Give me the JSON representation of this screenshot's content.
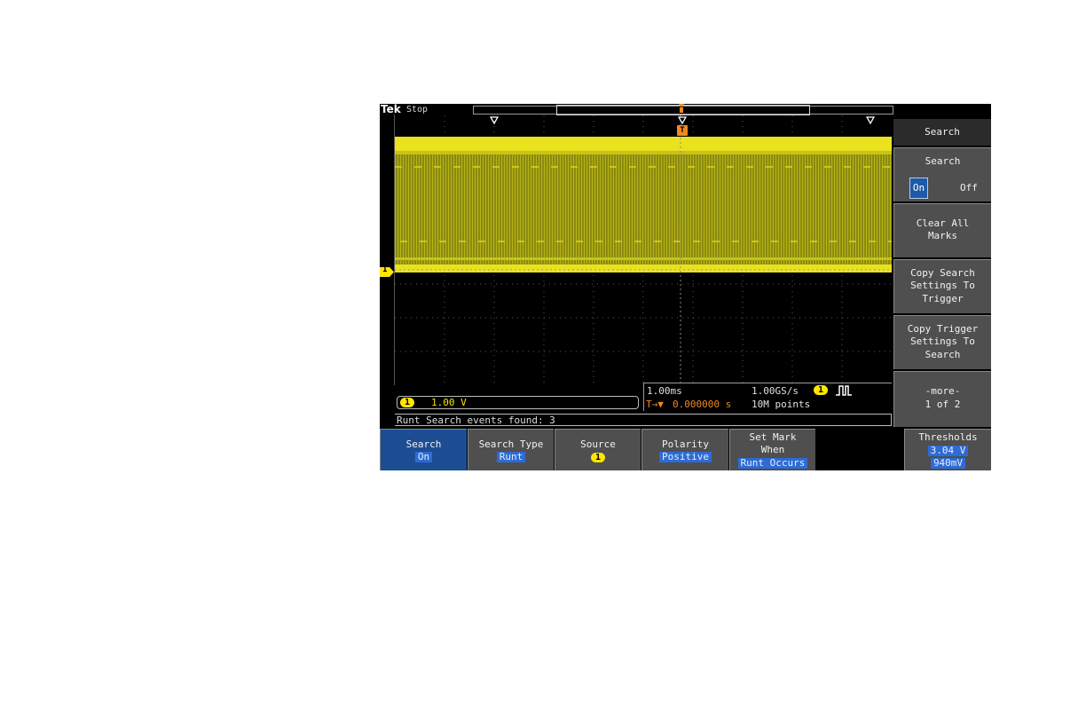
{
  "brand": "Tek",
  "run_state": "Stop",
  "channel1": {
    "badge": "1",
    "scale": "1.00 V"
  },
  "trigger_badge": "T",
  "timebase": {
    "horizontal_scale": "1.00ms",
    "sample_rate": "1.00GS/s",
    "trigger_position_symbol": "T→▼",
    "delay": "0.000000 s",
    "record_length": "10M points",
    "trigger_source_badge": "1"
  },
  "status_message": "Runt Search events found: 3",
  "side_menu": {
    "title": "Search",
    "search_toggle": {
      "label": "Search",
      "on": "On",
      "off": "Off"
    },
    "clear_all_marks": [
      "Clear All",
      "Marks"
    ],
    "copy_search_to_trigger": [
      "Copy Search",
      "Settings To",
      "Trigger"
    ],
    "copy_trigger_to_search": [
      "Copy Trigger",
      "Settings To",
      "Search"
    ],
    "more": [
      "-more-",
      "1 of 2"
    ]
  },
  "bottom_menu": {
    "search": {
      "label": "Search",
      "value": "On"
    },
    "search_type": {
      "label": "Search Type",
      "value": "Runt"
    },
    "source": {
      "label": "Source",
      "value": "1"
    },
    "polarity": {
      "label": "Polarity",
      "value": "Positive"
    },
    "set_mark_when": {
      "label_line1": "Set Mark",
      "label_line2": "When",
      "value": "Runt Occurs"
    },
    "thresholds": {
      "label": "Thresholds",
      "high": "3.04 V",
      "low": "940mV"
    }
  },
  "colors": {
    "channel1": "#ffe600",
    "trigger": "#f08a1e",
    "selected_button": "#1c4d93",
    "value_highlight": "#2e6bd4",
    "menu_button": "#4f4f4f"
  }
}
